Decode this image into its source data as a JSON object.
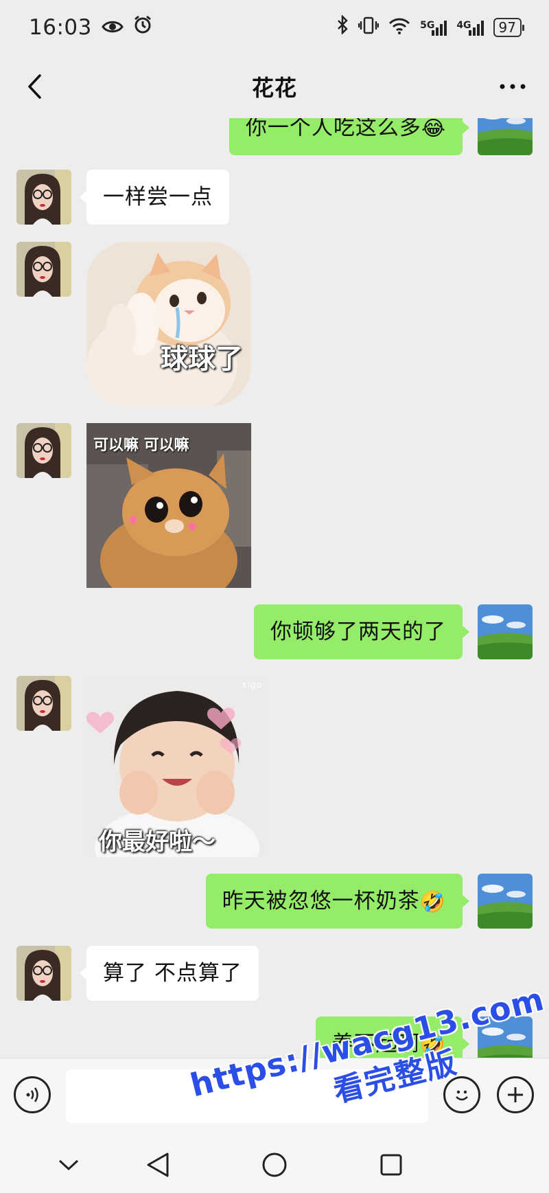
{
  "status_bar": {
    "time": "16:03",
    "icons": [
      "eye-icon",
      "alarm-icon",
      "bluetooth-icon",
      "vibrate-icon",
      "wifi-icon",
      "signal-5g-icon",
      "signal-4g-icon"
    ],
    "net_5g": "5G",
    "net_4g": "4G",
    "battery": "97"
  },
  "header": {
    "title": "花花",
    "back_icon": "chevron-left-icon",
    "more_icon": "more-dots-icon"
  },
  "messages": [
    {
      "side": "right",
      "type": "text",
      "text": "你一个人吃这么多",
      "emoji": "😂"
    },
    {
      "side": "left",
      "type": "text",
      "text": "一样尝一点"
    },
    {
      "side": "left",
      "type": "sticker",
      "caption": "球球了"
    },
    {
      "side": "left",
      "type": "sticker",
      "caption": "可以嘛 可以嘛"
    },
    {
      "side": "right",
      "type": "text",
      "text": "你顿够了两天的了"
    },
    {
      "side": "left",
      "type": "sticker",
      "caption": "你最好啦～",
      "tag": "xigo"
    },
    {
      "side": "right",
      "type": "text",
      "text": "昨天被忽悠一杯奶茶",
      "emoji": "🤣"
    },
    {
      "side": "left",
      "type": "text",
      "text": "算了 不点算了"
    },
    {
      "side": "right",
      "type": "text",
      "text": "养不起啊",
      "emoji": "🤣"
    }
  ],
  "input_bar": {
    "placeholder": "",
    "voice_icon": "voice-icon",
    "emoji_icon": "emoji-icon",
    "plus_icon": "plus-icon"
  },
  "nav_bar": {
    "icons": [
      "chevron-down-icon",
      "back-triangle-icon",
      "home-circle-icon",
      "recents-square-icon"
    ]
  },
  "watermark": {
    "url": "https://wacg13.com",
    "text": "看完整版"
  },
  "colors": {
    "background": "#ededed",
    "sent_bubble": "#95ec69",
    "received_bubble": "#ffffff",
    "watermark": "#2b4fe6"
  }
}
